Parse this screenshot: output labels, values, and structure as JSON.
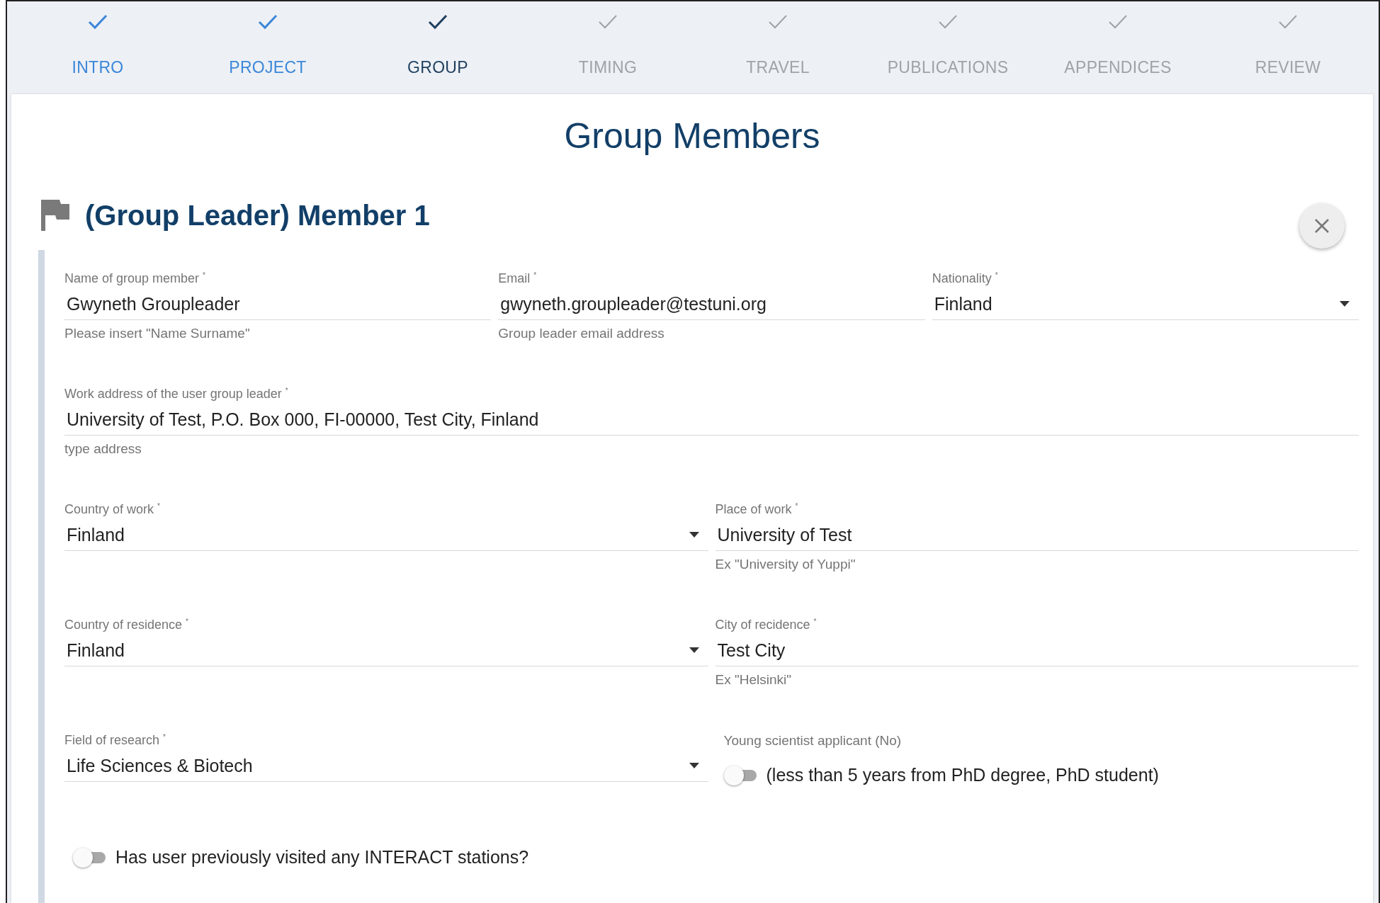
{
  "steps": [
    {
      "label": "INTRO",
      "completed": true,
      "selected": false
    },
    {
      "label": "PROJECT",
      "completed": true,
      "selected": false
    },
    {
      "label": "GROUP",
      "completed": true,
      "selected": true
    },
    {
      "label": "TIMING",
      "completed": false,
      "selected": false
    },
    {
      "label": "TRAVEL",
      "completed": false,
      "selected": false
    },
    {
      "label": "PUBLICATIONS",
      "completed": false,
      "selected": false
    },
    {
      "label": "APPENDICES",
      "completed": false,
      "selected": false
    },
    {
      "label": "REVIEW",
      "completed": false,
      "selected": false
    }
  ],
  "page_title": "Group Members",
  "member": {
    "title": "(Group Leader) Member 1",
    "rows": [
      [
        {
          "kind": "text",
          "label": "Name of group member $^{*}$",
          "value": "Gwyneth Groupleader",
          "helper": "Please insert \"Name Surname\""
        },
        {
          "kind": "text",
          "label": "Email $^{*}$",
          "value": "gwyneth.groupleader@testuni.org",
          "helper": "Group leader email address"
        },
        {
          "kind": "select",
          "label": "Nationality $^{*}$",
          "value": "Finland"
        }
      ],
      [
        {
          "kind": "text",
          "label": "Work address of the user group leader $^{*}$",
          "value": "University of Test, P.O. Box 000, FI-00000, Test City, Finland",
          "helper": "type address"
        }
      ],
      [
        {
          "kind": "select",
          "label": "Country of work $^{*}$",
          "value": "Finland"
        },
        {
          "kind": "text",
          "label": "Place of work $^{*}$",
          "value": "University of Test",
          "helper": "Ex \"University of Yuppi\""
        }
      ],
      [
        {
          "kind": "select",
          "label": "Country of residence $^{*}$",
          "value": "Finland"
        },
        {
          "kind": "text",
          "label": "City of recidence $^{*}$",
          "value": "Test City",
          "helper": "Ex \"Helsinki\""
        }
      ],
      [
        {
          "kind": "select",
          "label": "Field of research $^{*}$",
          "value": "Life Sciences & Biotech"
        },
        {
          "kind": "toggle",
          "label": "Young scientist applicant (No)",
          "text": "(less than 5 years from PhD degree, PhD student)",
          "on": false
        }
      ],
      [
        {
          "kind": "toggle",
          "text": "Has user previously visited any INTERACT stations?",
          "on": false
        }
      ]
    ]
  }
}
